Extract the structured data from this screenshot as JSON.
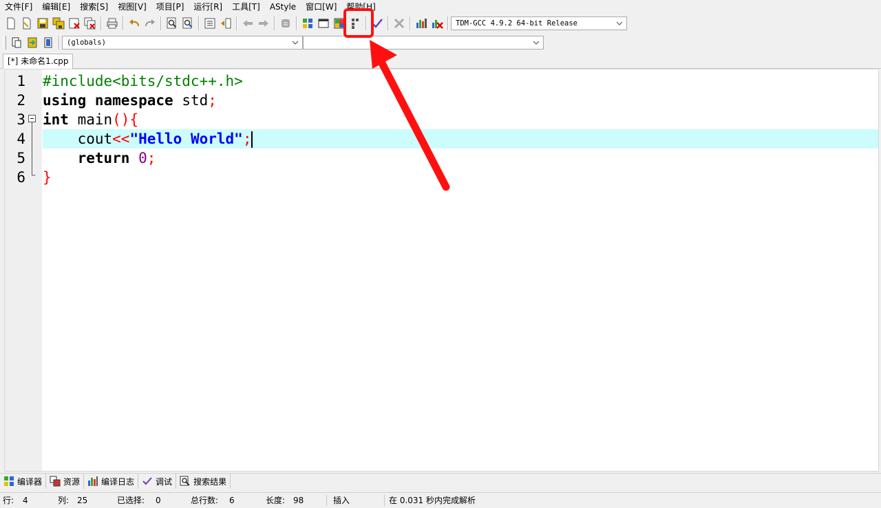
{
  "menu": [
    "文件[F]",
    "编辑[E]",
    "搜索[S]",
    "视图[V]",
    "项目[P]",
    "运行[R]",
    "工具[T]",
    "AStyle",
    "窗口[W]",
    "帮助[H]"
  ],
  "toolbar": {
    "compiler_select": "TDM-GCC 4.9.2 64-bit Release",
    "scope_select": "(globals)",
    "symbol_select": ""
  },
  "tab": {
    "label": "[*] 未命名1.cpp"
  },
  "editor": {
    "line_numbers": [
      "1",
      "2",
      "3",
      "4",
      "5",
      "6"
    ],
    "lines": [
      [
        {
          "t": "pre",
          "v": "#include<bits/stdc++.h>"
        }
      ],
      [
        {
          "t": "kw",
          "v": "using"
        },
        {
          "t": "id",
          "v": " "
        },
        {
          "t": "kw",
          "v": "namespace"
        },
        {
          "t": "id",
          "v": " std"
        },
        {
          "t": "op",
          "v": ";"
        }
      ],
      [
        {
          "t": "kw",
          "v": "int"
        },
        {
          "t": "id",
          "v": " main"
        },
        {
          "t": "op",
          "v": "(){"
        }
      ],
      [
        {
          "t": "id",
          "v": "    cout"
        },
        {
          "t": "op",
          "v": "<<"
        },
        {
          "t": "str",
          "v": "\"Hello World\""
        },
        {
          "t": "op",
          "v": ";"
        }
      ],
      [
        {
          "t": "id",
          "v": "    "
        },
        {
          "t": "kw",
          "v": "return"
        },
        {
          "t": "id",
          "v": " "
        },
        {
          "t": "num",
          "v": "0"
        },
        {
          "t": "op",
          "v": ";"
        }
      ],
      [
        {
          "t": "op",
          "v": "}"
        }
      ]
    ],
    "current_line": 4
  },
  "bottom_tabs": [
    "编译器",
    "资源",
    "编译日志",
    "调试",
    "搜索结果"
  ],
  "status": {
    "row_label": "行:",
    "row_value": "4",
    "col_label": "列:",
    "col_value": "25",
    "sel_label": "已选择:",
    "sel_value": "0",
    "total_label": "总行数:",
    "total_value": "6",
    "len_label": "长度:",
    "len_value": "98",
    "mode": "插入",
    "message": "在 0.031 秒内完成解析"
  },
  "colors": {
    "annotation": "#ff1010",
    "current_line": "#ccfcfc"
  }
}
